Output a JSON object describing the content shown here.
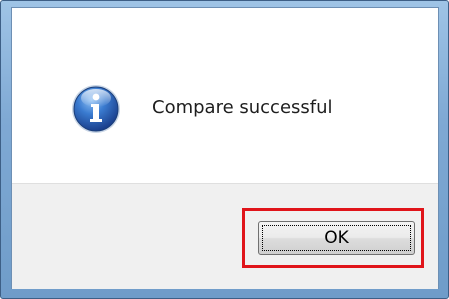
{
  "dialog": {
    "icon": "information-icon",
    "message": "Compare successful",
    "ok_label": "OK"
  },
  "colors": {
    "frame": "#7fa9d4",
    "highlight": "#e0141a",
    "icon_blue": "#2a63b8"
  }
}
